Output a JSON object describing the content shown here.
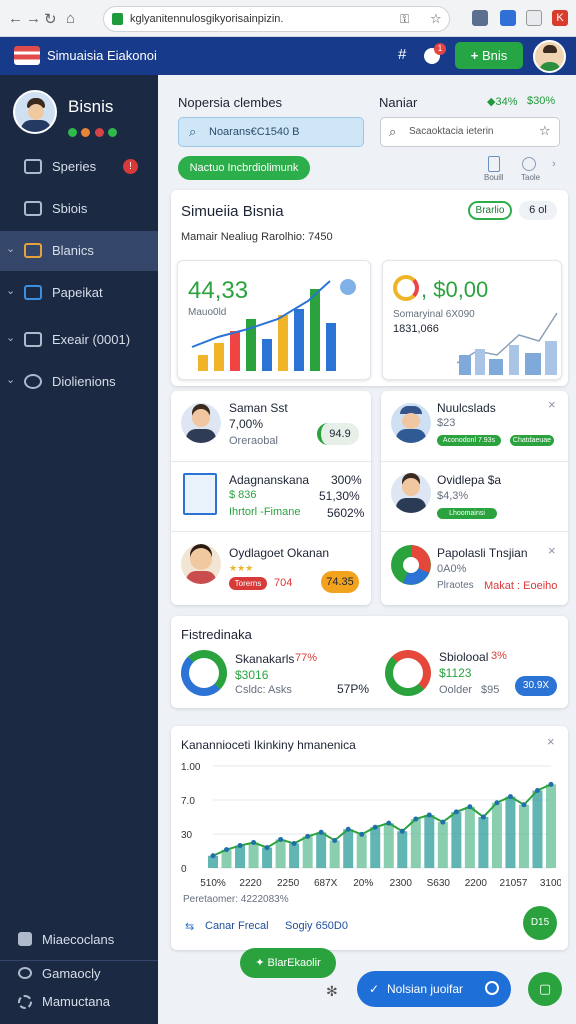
{
  "browser": {
    "url": "kglyanitennulosgikyorisainpizin.",
    "nav_icons": [
      "back-icon",
      "forward-icon",
      "reload-icon",
      "home-icon"
    ]
  },
  "header": {
    "title": "Simuaisia Eiakonoi",
    "cta_label": "Bnis",
    "badge": "1"
  },
  "sidebar": {
    "profile_name": "Bisnis",
    "items": [
      {
        "label": "Speries",
        "icon": "chart-icon",
        "badge": "!"
      },
      {
        "label": "Sbiois",
        "icon": "folder-icon"
      },
      {
        "label": "Blanics",
        "icon": "table-icon"
      },
      {
        "label": "Papeikat",
        "icon": "map-icon"
      },
      {
        "label": "Exeair (0001)",
        "icon": "drawer-icon"
      },
      {
        "label": "Diolienions",
        "icon": "people-icon"
      }
    ],
    "bottom_items": [
      {
        "label": "Miaecoclans",
        "icon": "grid-icon"
      },
      {
        "label": "Gamaocly",
        "icon": "users-icon"
      },
      {
        "label": "Mamuctana",
        "icon": "settings-icon"
      }
    ]
  },
  "topbar": {
    "left_label": "Nopersia clembes",
    "search_value": "Noarans€C1540 B",
    "right_label": "Naniar",
    "stat_1": "34%",
    "stat_2": "$30%",
    "search2_value": "Sacaoktacia ieterin",
    "primary_action": "Nactuo Incbrdiolimunk",
    "icon1_label": "Bouill",
    "icon2_label": "Taole"
  },
  "overview": {
    "title": "Simueiia Bisnia",
    "status_badge": "Brarlio",
    "count": "6 ol",
    "subtitle": "Mamair Nealiug Rarolhio: 7450",
    "left_value": "44,33",
    "left_sub": "Mauo0ld",
    "right_value": ", $0,00",
    "right_sub1": "Somaryinal 6X090",
    "right_sub2": "1831,066"
  },
  "people": {
    "left": [
      {
        "name": "Saman Sst",
        "value": "7,00%",
        "meta": "Oreraobal",
        "badge": "94.9"
      },
      {
        "name": "Adagnanskana",
        "value": "$ 836",
        "meta": "Ihrtorl -Fimane",
        "stats": [
          "300%",
          "51,30%",
          "5602%"
        ]
      },
      {
        "name": "Oydlagoet Okanan",
        "value": "Torerns",
        "meta": "704",
        "badge": "74.35"
      }
    ],
    "right": [
      {
        "name": "Nuulcslads",
        "value": "$23",
        "tags": [
          "Aconodonl 7.93s",
          "Chatdaeuae"
        ]
      },
      {
        "name": "Ovidlepa $a",
        "value": "$4,3%",
        "tags": [
          "Lhoomainsi"
        ]
      },
      {
        "name": "Papolasli Tnsjian",
        "value": "0A0%",
        "meta": "Plraotes",
        "alert": "Makat : Eoeiho"
      }
    ]
  },
  "distribution": {
    "title": "Fistredinaka",
    "left": {
      "name": "Skanakarls",
      "pct": "77%",
      "value": "$3016",
      "meta": "Csldc: Asks",
      "side": "57P%"
    },
    "right": {
      "name": "Sbiolooal",
      "pct": "3%",
      "value": "$1123",
      "meta": "Oolder",
      "side": "$95",
      "badge": "30.9X"
    }
  },
  "chart_data": {
    "type": "area",
    "title": "Kanannioceti Ikinkiny hmanenica",
    "x": [
      "510%",
      "2220",
      "2250",
      "687X",
      "20%",
      "2300",
      "S630",
      "2200",
      "21057",
      "3100"
    ],
    "y_ticks": [
      "1.00",
      "7.0",
      "30",
      "0"
    ],
    "values": [
      12,
      18,
      22,
      25,
      20,
      28,
      24,
      31,
      35,
      27,
      38,
      33,
      40,
      44,
      36,
      48,
      52,
      45,
      55,
      60,
      50,
      64,
      70,
      62,
      76,
      82
    ],
    "ylim": [
      0,
      100
    ],
    "footer_label": "Peretaomer: 4222083%",
    "link1": "Canar Frecal",
    "link2": "Sogiy 650D0",
    "fab": "D15"
  },
  "bottombar": {
    "action_label": "BlarEkaolir",
    "primary_label": "Nolsian juoifar"
  }
}
